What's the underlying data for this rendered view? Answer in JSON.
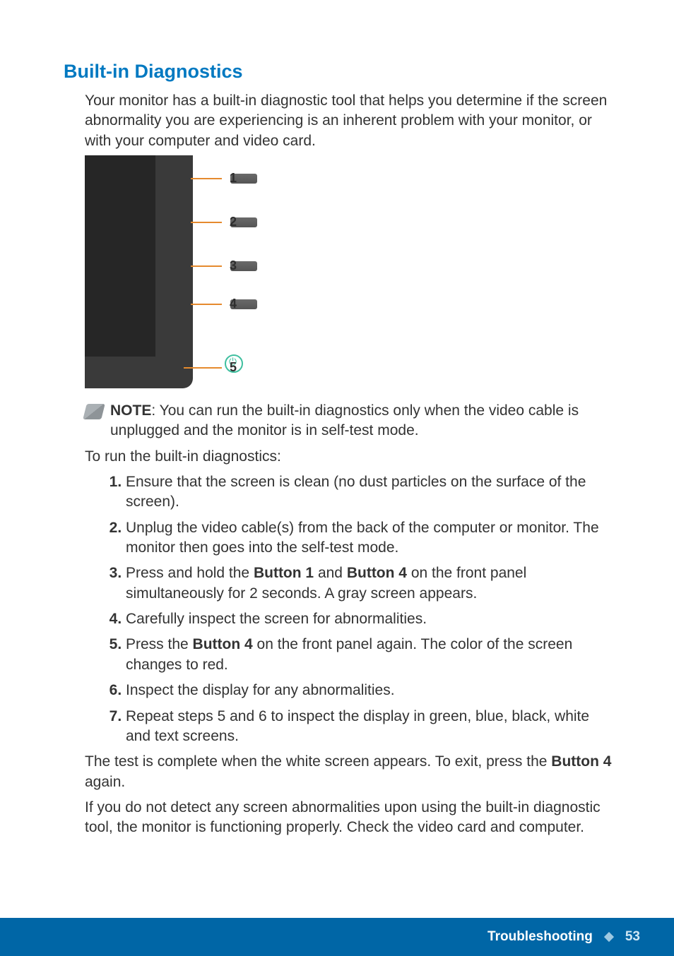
{
  "heading": "Built-in Diagnostics",
  "intro": "Your monitor has a built-in diagnostic tool that helps you determine if the screen abnormality you are experiencing is an inherent problem with your monitor, or with your computer and video card.",
  "diagram": {
    "labels": {
      "n1": "1",
      "n2": "2",
      "n3": "3",
      "n4": "4",
      "n5": "5"
    }
  },
  "note": {
    "label": "NOTE",
    "text": ": You can run the built-in diagnostics only when the video cable is unplugged and the monitor is in self-test mode."
  },
  "run_line": "To run the built-in diagnostics:",
  "steps": {
    "s1": "Ensure that the screen is clean (no dust particles on the surface of the screen).",
    "s2": "Unplug the video cable(s) from the back of the computer or monitor. The monitor then goes into the self-test mode.",
    "s3a": "Press and hold the ",
    "s3b1": "Button 1",
    "s3mid": " and ",
    "s3b2": "Button 4",
    "s3c": " on the front panel simultaneously for 2 seconds. A gray screen appears.",
    "s4": "Carefully inspect the screen for abnormalities.",
    "s5a": "Press the ",
    "s5b": "Button 4",
    "s5c": " on the front panel again. The color of the screen changes to red.",
    "s6": "Inspect the display for any abnormalities.",
    "s7": "Repeat steps 5 and 6 to inspect the display in green, blue, black, white and text screens."
  },
  "closing1a": "The test is complete when the white screen appears. To exit, press the ",
  "closing1b": "Button 4",
  "closing1c": " again.",
  "closing2": "If you do not detect any screen abnormalities upon using the built-in diagnostic tool, the monitor is functioning properly. Check the video card and computer.",
  "footer": {
    "section": "Troubleshooting",
    "page": "53"
  }
}
